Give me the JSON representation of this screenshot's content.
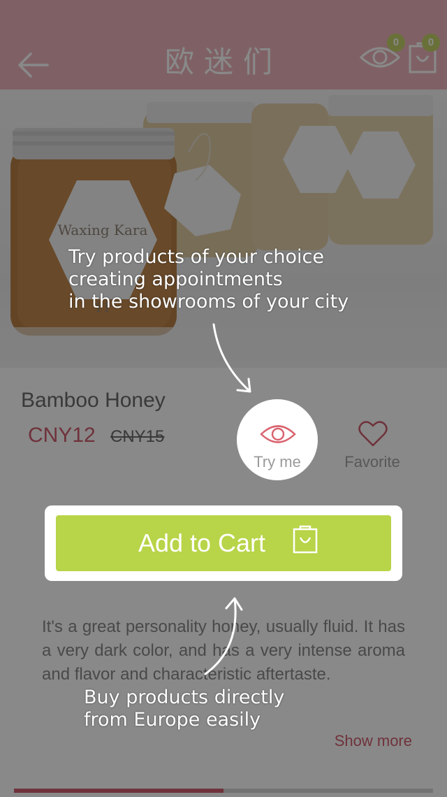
{
  "header": {
    "title": "欧迷们",
    "watch_count": "0",
    "cart_count": "0"
  },
  "product": {
    "name": "Bamboo Honey",
    "price": "CNY12",
    "old_price": "CNY15",
    "image_icon": "honey-jars-photo"
  },
  "actions": {
    "try_label": "Try me",
    "favorite_label": "Favorite",
    "add_to_cart_label": "Add to Cart"
  },
  "description": {
    "text": "It's a great personality honey, usually fluid. It has a very dark color, and has a very intense aroma and flavor and characteristic aftertaste.",
    "show_more": "Show more"
  },
  "tips": {
    "try_tip": "Try products of your choice\ncreating appointments\nin the showrooms of your city",
    "buy_tip": "Buy products directly\nfrom Europe easily"
  },
  "colors": {
    "header": "#e8a5ad",
    "accent": "#c5394e",
    "cart_button": "#b8d448",
    "badge": "#b7c84a"
  }
}
